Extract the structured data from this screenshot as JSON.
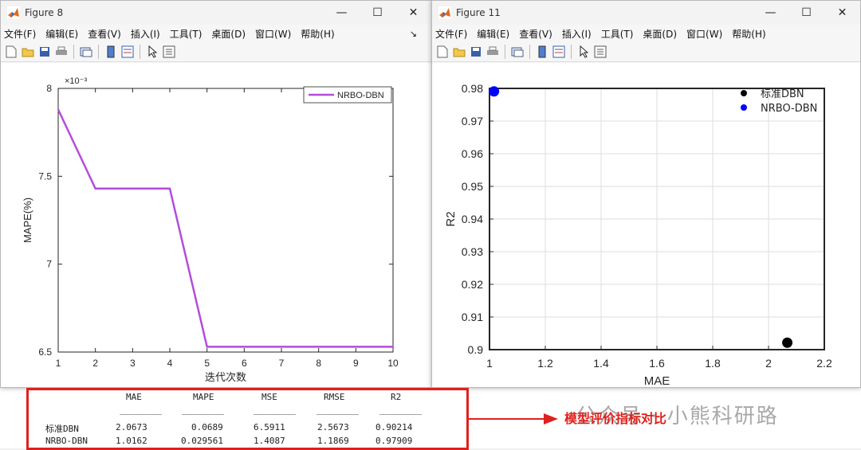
{
  "figure8": {
    "title": "Figure 8",
    "menu": [
      "文件(F)",
      "编辑(E)",
      "查看(V)",
      "插入(I)",
      "工具(T)",
      "桌面(D)",
      "窗口(W)",
      "帮助(H)"
    ],
    "menu_more": "↘",
    "window_controls": {
      "minimize": "—",
      "maximize": "☐",
      "close": "✕"
    }
  },
  "figure11": {
    "title": "Figure 11",
    "menu": [
      "文件(F)",
      "编辑(E)",
      "查看(V)",
      "插入(I)",
      "工具(T)",
      "桌面(D)",
      "窗口(W)",
      "帮助(H)"
    ],
    "window_controls": {
      "minimize": "—",
      "maximize": "☐",
      "close": "✕"
    }
  },
  "chart_data": [
    {
      "type": "line",
      "xlabel": "迭代次数",
      "ylabel": "MAPE(%)",
      "y_exponent_label": "×10⁻³",
      "xlim": [
        1,
        10
      ],
      "ylim": [
        6.5,
        8
      ],
      "x_ticks": [
        1,
        2,
        3,
        4,
        5,
        6,
        7,
        8,
        9,
        10
      ],
      "y_ticks": [
        6.5,
        7,
        7.5,
        8
      ],
      "y_tick_labels": [
        "6.5",
        "7",
        "7.5",
        "8"
      ],
      "grid": false,
      "legend": "top-right",
      "series": [
        {
          "name": "NRBO-DBN",
          "color": "#b44cdc",
          "x": [
            1,
            2,
            3,
            4,
            5,
            6,
            7,
            8,
            9,
            10
          ],
          "y": [
            7.88,
            7.43,
            7.43,
            7.43,
            6.53,
            6.53,
            6.53,
            6.53,
            6.53,
            6.53
          ]
        }
      ]
    },
    {
      "type": "scatter",
      "xlabel": "MAE",
      "ylabel": "R2",
      "xlim": [
        1,
        2.2
      ],
      "ylim": [
        0.9,
        0.98
      ],
      "x_ticks": [
        1,
        1.2,
        1.4,
        1.6,
        1.8,
        2,
        2.2
      ],
      "x_tick_labels": [
        "1",
        "1.2",
        "1.4",
        "1.6",
        "1.8",
        "2",
        "2.2"
      ],
      "y_ticks": [
        0.9,
        0.91,
        0.92,
        0.93,
        0.94,
        0.95,
        0.96,
        0.97,
        0.98
      ],
      "y_tick_labels": [
        "0.9",
        "0.91",
        "0.92",
        "0.93",
        "0.94",
        "0.95",
        "0.96",
        "0.97",
        "0.98"
      ],
      "grid": true,
      "legend": "top-right",
      "series": [
        {
          "name": "标准DBN",
          "color": "#000000",
          "x": [
            2.0673
          ],
          "y": [
            0.90214
          ]
        },
        {
          "name": "NRBO-DBN",
          "color": "#0000ff",
          "x": [
            1.0162
          ],
          "y": [
            0.97909
          ]
        }
      ]
    }
  ],
  "console": {
    "headers": [
      "MAE",
      "MAPE",
      "MSE",
      "RMSE",
      "R2"
    ],
    "rows": [
      {
        "label": "标准DBN",
        "values": [
          "2.0673",
          "0.0689",
          "6.5911",
          "2.5673",
          "0.90214"
        ]
      },
      {
        "label": "NRBO-DBN",
        "values": [
          "1.0162",
          "0.029561",
          "1.4087",
          "1.1869",
          "0.97909"
        ]
      }
    ],
    "underline": "________"
  },
  "annotation": "模型评价指标对比",
  "watermark": "公众号 · 小熊科研路",
  "colors": {
    "highlight": "#e0201c",
    "line": "#b44cdc",
    "standard": "#000000",
    "nrbo": "#0000ff"
  }
}
